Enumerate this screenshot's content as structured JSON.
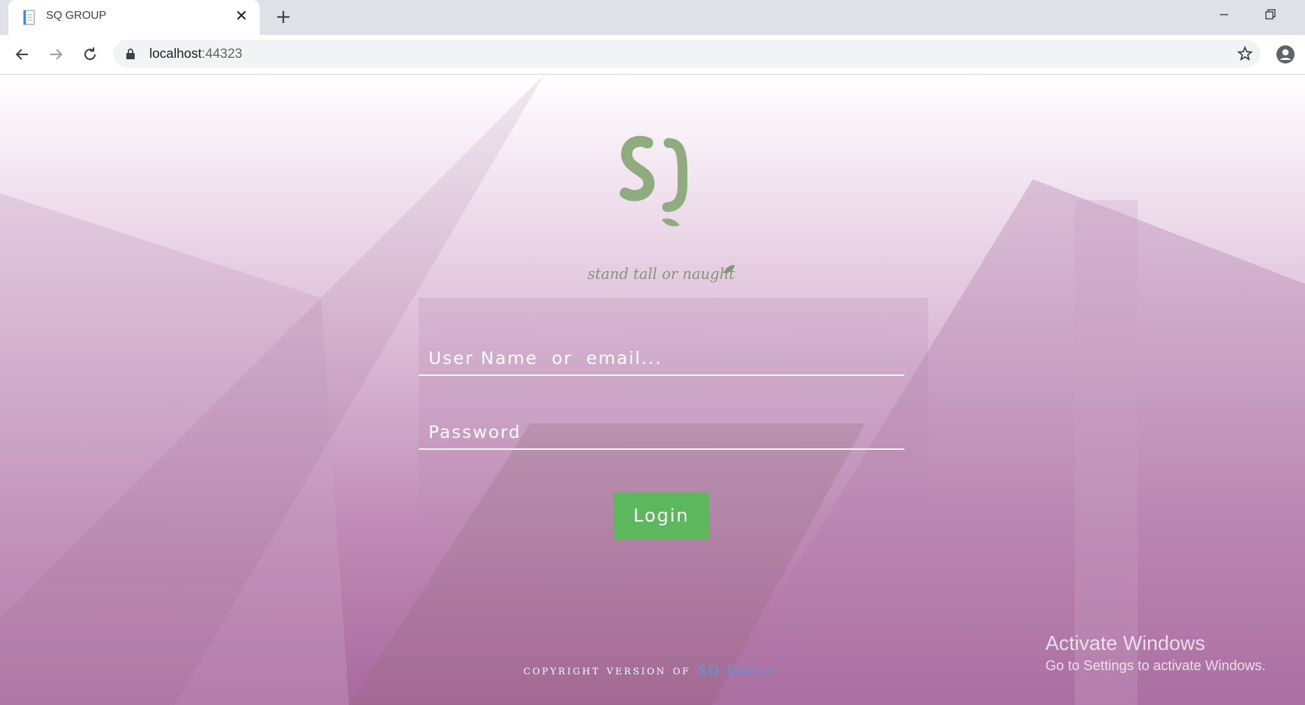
{
  "browser": {
    "tab_title": "SQ GROUP",
    "tab_close": "✕",
    "new_tab": "+",
    "url_host": "localhost",
    "url_port": ":44323"
  },
  "page": {
    "logo_text": "SQ",
    "tagline": "stand tall or naught",
    "username_placeholder": "User Name  or  email...",
    "username_value": "",
    "password_placeholder": "Password",
    "password_value": "",
    "login_label": "Login",
    "copyright_prefix": "copyright version of",
    "copyright_brand": "SQ Group"
  },
  "os_overlay": {
    "activate_title": "Activate Windows",
    "activate_subtitle": "Go to Settings to activate Windows."
  },
  "colors": {
    "login_button": "#5cb85c",
    "logo_green": "#8fac7f",
    "brand_blue": "#4aa3df"
  }
}
